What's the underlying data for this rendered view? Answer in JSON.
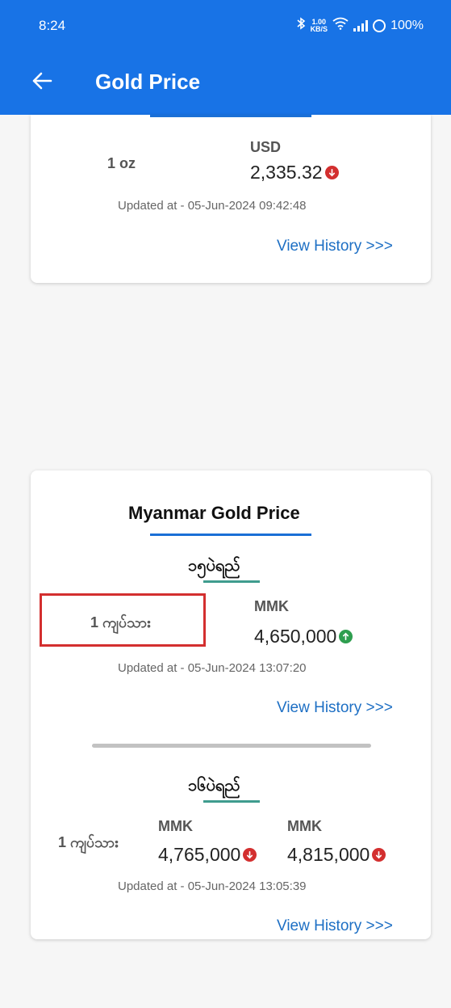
{
  "status_bar": {
    "time": "8:24",
    "net_rate_value": "1.00",
    "net_rate_unit": "KB/S",
    "battery": "100%"
  },
  "header": {
    "title": "Gold Price"
  },
  "world_card": {
    "unit": "1 oz",
    "currency": "USD",
    "price": "2,335.32",
    "trend": "down",
    "updated": "Updated at - 05-Jun-2024 09:42:48",
    "history_link": "View History >>>"
  },
  "myanmar_card": {
    "title": "Myanmar Gold Price",
    "section1": {
      "title": "၁၅ပဲရည်",
      "unit": "1 ကျပ်သား",
      "currency": "MMK",
      "price": "4,650,000",
      "trend": "up",
      "updated": "Updated at - 05-Jun-2024 13:07:20",
      "history_link": "View History >>>"
    },
    "section2": {
      "title": "၁၆ပဲရည်",
      "unit": "1 ကျပ်သား",
      "currency1": "MMK",
      "price1": "4,765,000",
      "trend1": "down",
      "currency2": "MMK",
      "price2": "4,815,000",
      "trend2": "down",
      "updated": "Updated at - 05-Jun-2024 13:05:39",
      "history_link": "View History >>>"
    }
  },
  "colors": {
    "primary": "#1873e6",
    "down": "#d32f2f",
    "up": "#2e9e4f",
    "link": "#1d6fc4"
  }
}
